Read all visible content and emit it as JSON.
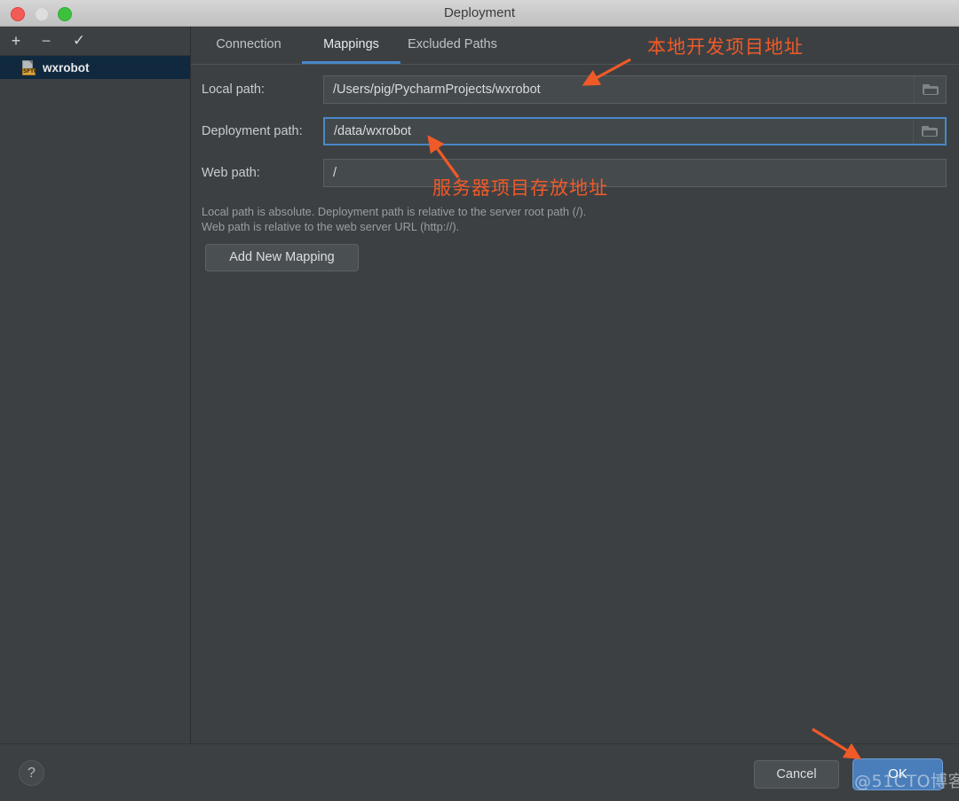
{
  "window": {
    "title": "Deployment",
    "controls": {
      "close": "close-button",
      "minimize": "minimize-button",
      "maximize": "maximize-button"
    }
  },
  "sidebar": {
    "toolbar": {
      "add": "+",
      "remove": "−",
      "check": "✓"
    },
    "servers": [
      {
        "name": "wxrobot",
        "protocol": "SFTP",
        "selected": true
      }
    ]
  },
  "tabs": [
    {
      "label": "Connection",
      "selected": false
    },
    {
      "label": "Mappings",
      "selected": true
    },
    {
      "label": "Excluded Paths",
      "selected": false
    }
  ],
  "form": {
    "fields": [
      {
        "label": "Local path:",
        "value": "/Users/pig/PycharmProjects/wxrobot",
        "has_browse": true,
        "focused": false
      },
      {
        "label": "Deployment path:",
        "value": "/data/wxrobot",
        "has_browse": true,
        "focused": true
      },
      {
        "label": "Web path:",
        "value": "/",
        "has_browse": false,
        "focused": false
      }
    ],
    "hint_line1": "Local path is absolute. Deployment path is relative to the server root path (/).",
    "hint_line2": "Web path is relative to the web server URL (http://).",
    "add_mapping_label": "Add New Mapping"
  },
  "footer": {
    "help_label": "?",
    "cancel_label": "Cancel",
    "ok_label": "OK"
  },
  "annotations": [
    {
      "text": "本地开发项目地址",
      "color": "#f05a28"
    },
    {
      "text": "服务器项目存放地址",
      "color": "#f05a28"
    }
  ],
  "watermark": {
    "text": "@51CTO博客"
  }
}
